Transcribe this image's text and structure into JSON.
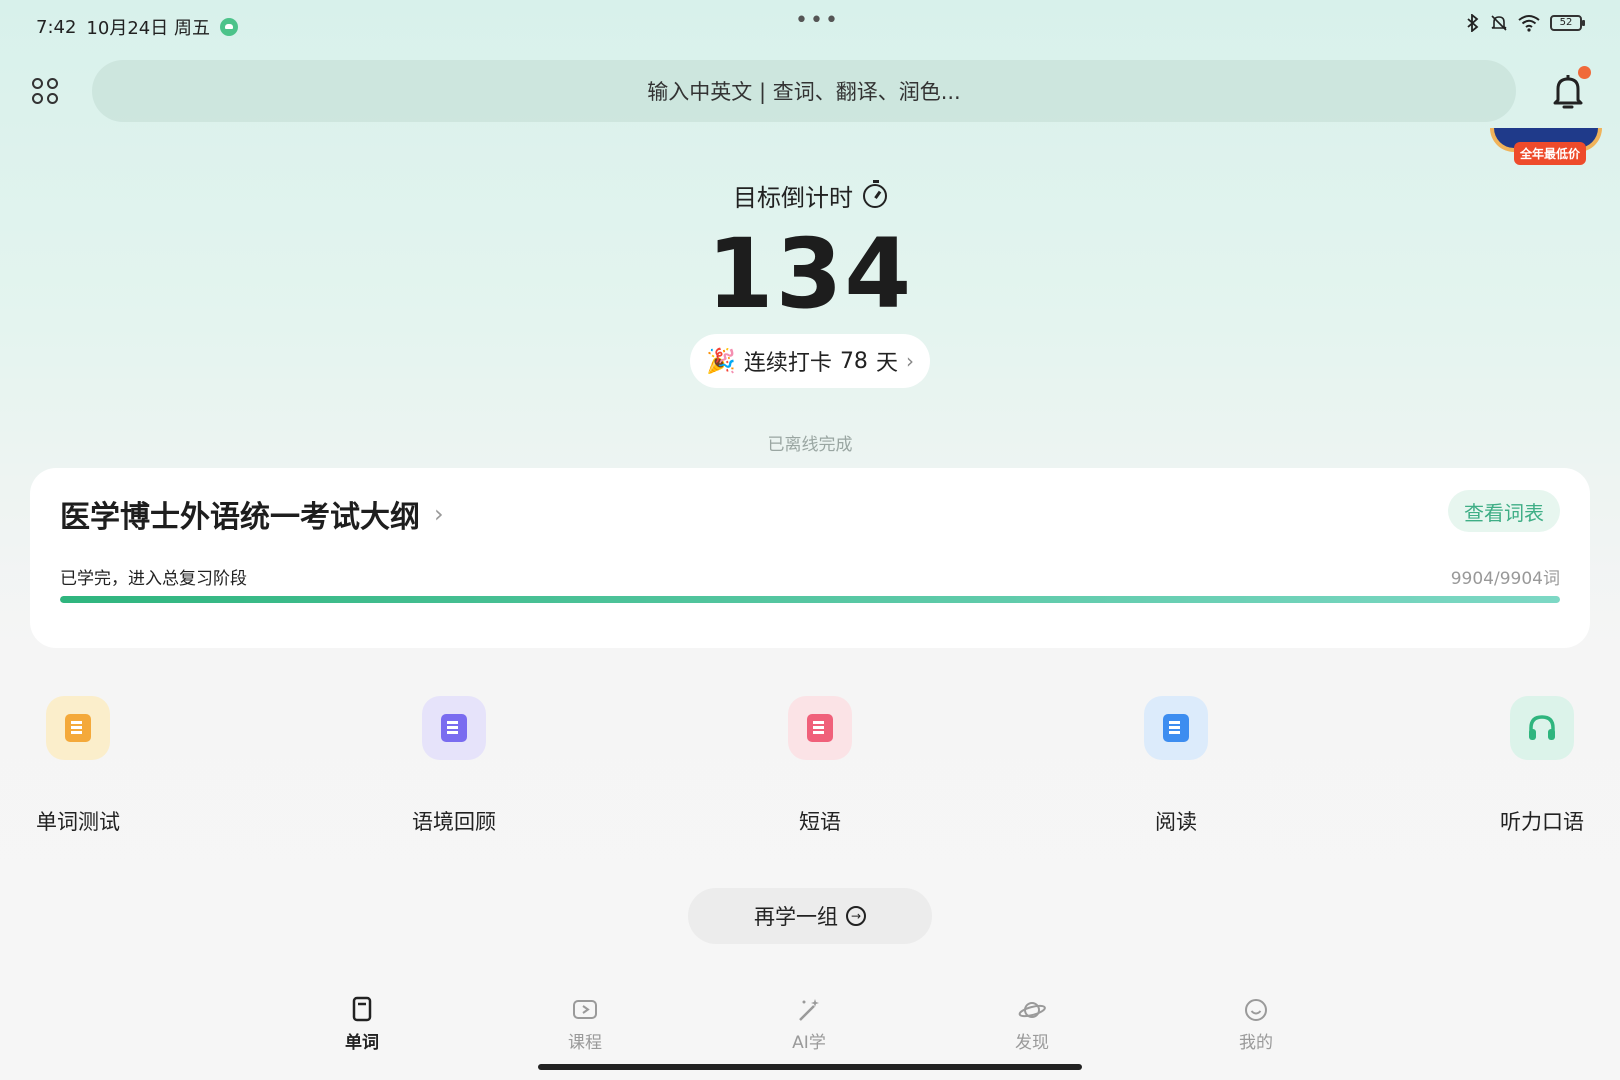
{
  "status_bar": {
    "time": "7:42",
    "date": "10月24日 周五",
    "more": "•••",
    "battery": "52"
  },
  "search": {
    "placeholder": "输入中英文 | 查词、翻译、润色..."
  },
  "promo": {
    "tag": "全年最低价"
  },
  "countdown": {
    "title": "目标倒计时",
    "days": "134"
  },
  "streak": {
    "prefix": "连续打卡",
    "days": "78",
    "suffix": "天"
  },
  "offline_text": "已离线完成",
  "wordbook": {
    "title": "医学博士外语统一考试大纲",
    "view_list": "查看词表",
    "status": "已学完，进入总复习阶段",
    "count": "9904/9904词",
    "progress": 1.0
  },
  "features": [
    {
      "label": "单词测试",
      "icon": "word-test-icon",
      "bg": "#fbeecb",
      "fg": "#f4a93a"
    },
    {
      "label": "语境回顾",
      "icon": "context-review-icon",
      "bg": "#e6e3fa",
      "fg": "#7a6cf0"
    },
    {
      "label": "短语",
      "icon": "phrase-icon",
      "bg": "#fbe3e6",
      "fg": "#f0607a"
    },
    {
      "label": "阅读",
      "icon": "reading-icon",
      "bg": "#dcebfb",
      "fg": "#3d8df0"
    },
    {
      "label": "听力口语",
      "icon": "headphones-icon",
      "bg": "#dcf3ea",
      "fg": "#2fb57e"
    }
  ],
  "again_button": "再学一组",
  "nav": [
    {
      "label": "单词",
      "icon": "word-card-icon",
      "active": true
    },
    {
      "label": "课程",
      "icon": "play-icon",
      "active": false
    },
    {
      "label": "AI学",
      "icon": "magic-wand-icon",
      "active": false
    },
    {
      "label": "发现",
      "icon": "planet-icon",
      "active": false
    },
    {
      "label": "我的",
      "icon": "smile-icon",
      "active": false
    }
  ],
  "colors": {
    "accent": "#2fb57e",
    "badge": "#f06a3a"
  }
}
